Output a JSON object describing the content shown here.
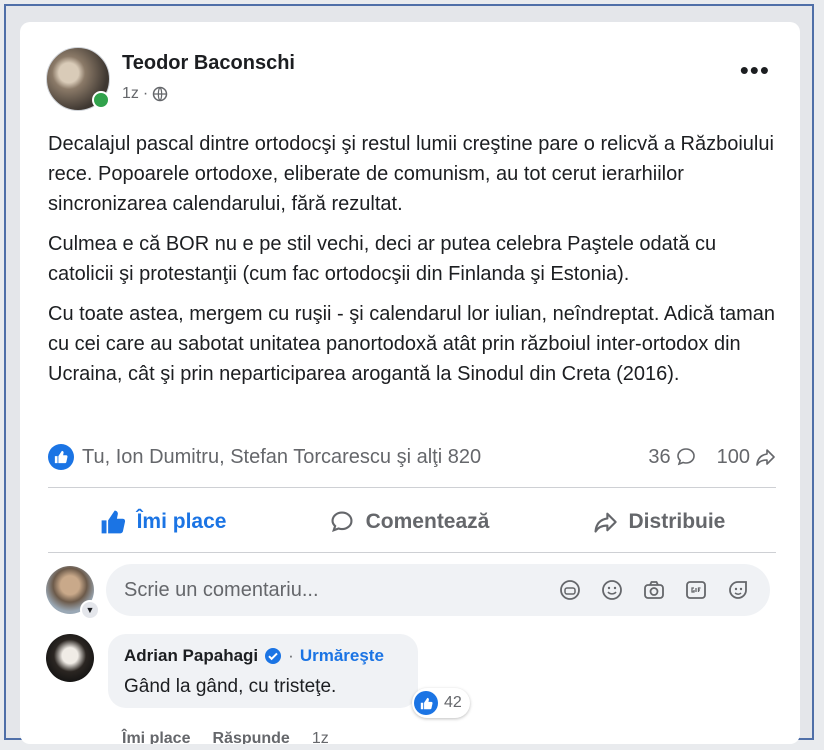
{
  "post": {
    "author": "Teodor Baconschi",
    "time": "1z",
    "more": "•••",
    "paragraphs": [
      "Decalajul pascal dintre ortodocşi şi restul lumii creştine pare o relicvă a Războiului rece. Popoarele ortodoxe, eliberate de comunism, au tot cerut ierarhiilor sincronizarea calendarului, fără rezultat.",
      "Culmea e că BOR nu e pe stil vechi, deci ar putea celebra Paştele odată cu catolicii şi protestanţii (cum fac ortodocşii din Finlanda şi Estonia).",
      "Cu toate astea, mergem cu ruşii - şi calendarul lor iulian, neîndreptat. Adică taman cu cei care au sabotat unitatea panortodoxă atât prin războiul inter-ortodox din Ucraina, cât şi prin neparticiparea arogantă la Sinodul din Creta (2016)."
    ]
  },
  "reactions": {
    "reactors": "Tu, Ion Dumitru, Stefan Torcarescu şi alţi 820",
    "comments_count": "36",
    "shares_count": "100"
  },
  "actions": {
    "like": "Îmi place",
    "comment": "Comentează",
    "share": "Distribuie"
  },
  "composer": {
    "placeholder": "Scrie un comentariu..."
  },
  "comment": {
    "author": "Adrian Papahagi",
    "follow": "Urmăreşte",
    "text": "Gând la gând, cu tristeţe.",
    "reaction_count": "42",
    "like": "Îmi place",
    "reply": "Răspunde",
    "time": "1z"
  },
  "colors": {
    "accent": "#1b74e4",
    "online": "#31a24c",
    "secondary_text": "#65676b"
  }
}
